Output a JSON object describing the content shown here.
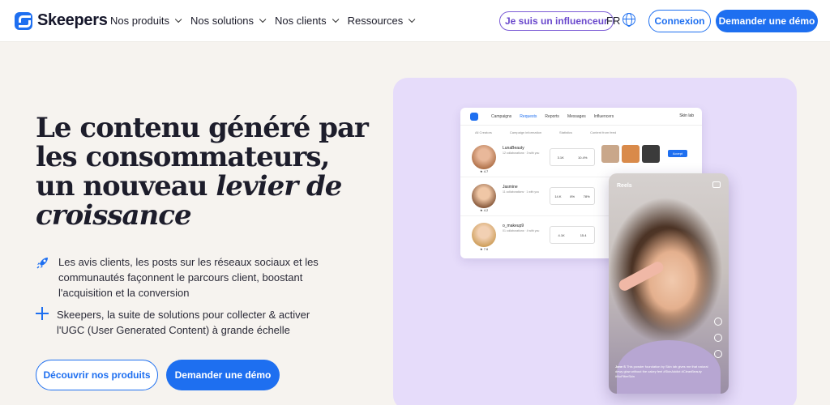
{
  "brand": {
    "name": "Skeepers"
  },
  "nav": {
    "items": [
      {
        "label": "Nos produits"
      },
      {
        "label": "Nos solutions"
      },
      {
        "label": "Nos clients"
      },
      {
        "label": "Ressources"
      }
    ],
    "influencer_label": "Je suis un influenceur",
    "lang": "FR",
    "login_label": "Connexion",
    "demo_label": "Demander une démo"
  },
  "hero": {
    "title_line1": "Le contenu généré par",
    "title_line2": "les consommateurs,",
    "title_line3": "un nouveau ",
    "title_italic1": "levier de",
    "title_italic2": "croissance",
    "feature1": "Les avis clients, les posts sur les réseaux sociaux et les communautés façonnent le parcours client, boostant l'acquisition et la conversion",
    "feature2": "Skeepers, la suite de solutions pour collecter & activer l'UGC (User Generated Content) à grande échelle",
    "discover_label": "Découvrir nos produits",
    "demo_label": "Demander une démo"
  },
  "dashboard": {
    "tabs": [
      "Campaigns",
      "Requests",
      "Reports",
      "Messages",
      "Influencers"
    ],
    "active_tab": "Requests",
    "user": "Skin lab",
    "headers": [
      "All Creators",
      "Campaign information",
      "Statistics",
      "Content from feed"
    ],
    "rows": [
      {
        "name": "LunaBeauty",
        "sub": "12 collaborations · 3 with you",
        "rating": "4.7",
        "stats": [
          "3.1K",
          "10.4%"
        ],
        "accept": "Accept"
      },
      {
        "name": "Jasmine",
        "sub": "11 collaborations · 1 with you",
        "rating": "4.2",
        "stats": [
          "14.K",
          "8%",
          "78%"
        ]
      },
      {
        "name": "o_makeup9",
        "sub": "01 collaborations · 4 with you",
        "rating": "7.6",
        "stats": [
          "4.1K",
          "15.4"
        ]
      }
    ]
  },
  "reel": {
    "label": "Reels",
    "caption_name": "Jane S",
    "caption_text": "This powder foundation by Skin lab gives me that natural dewy glow without the cakey feel",
    "caption_tags": "#SkinAddict #CleanBeauty #NoFilterSkin"
  },
  "colors": {
    "accent": "#1e6ff0",
    "influencer": "#6a48cc",
    "panel": "#e6dcfa"
  }
}
